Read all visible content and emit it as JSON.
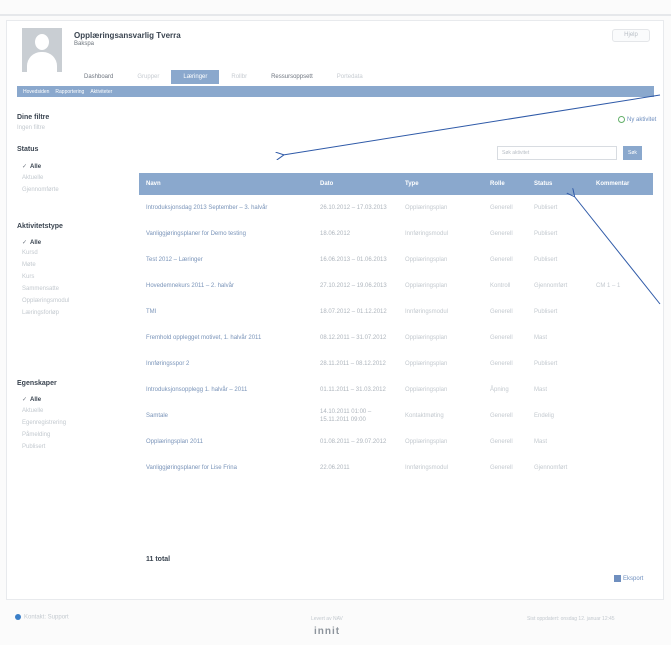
{
  "header": {
    "title": "Opplæringsansvarlig Tverra",
    "subtitle": "Bakspa",
    "help_label": "Hjelp"
  },
  "tabs": [
    {
      "label": "Dashboard",
      "state": "normal"
    },
    {
      "label": "Grupper",
      "state": "faint"
    },
    {
      "label": "Læringer",
      "state": "active"
    },
    {
      "label": "Rollbr",
      "state": "faint"
    },
    {
      "label": "Ressursoppsett",
      "state": "normal"
    },
    {
      "label": "Portedata",
      "state": "faint"
    }
  ],
  "subnav": [
    "Hovedsiden",
    "Rapportering",
    "Aktiviteter"
  ],
  "sidebar": {
    "filters_title": "Dine filtre",
    "filters_sub": "Ingen filtre",
    "status": {
      "title": "Status",
      "items": [
        "Alle",
        "Aktuelle",
        "Gjennomførte"
      ]
    },
    "activity_type": {
      "title": "Aktivitetstype",
      "items": [
        "Alle",
        "Kursd",
        "Møte",
        "Kurs",
        "Sammensatte",
        "Opplæringsmodul",
        "Læringsforløp"
      ]
    },
    "properties": {
      "title": "Egenskaper",
      "items": [
        "Alle",
        "Aktuelle",
        "Egenregistrering",
        "Påmelding",
        "Publisert"
      ]
    }
  },
  "new_activity_label": "Ny aktivitet",
  "search": {
    "placeholder": "Søk aktivitet",
    "button": "Søk"
  },
  "table": {
    "columns": [
      "Navn",
      "Dato",
      "Type",
      "Rolle",
      "Status",
      "Kommentar"
    ],
    "rows": [
      {
        "name": "Introduksjonsdag 2013 September – 3. halvår",
        "date": "26.10.2012 – 17.03.2013",
        "type": "Opplæringsplan",
        "role": "Generell",
        "status": "Publisert",
        "comment": ""
      },
      {
        "name": "Vanliggjøringsplaner for Demo testing",
        "date": "18.06.2012",
        "type": "Innføringsmodul",
        "role": "Generell",
        "status": "Publisert",
        "comment": ""
      },
      {
        "name": "Test 2012 – Læringer",
        "date": "16.06.2013 – 01.06.2013",
        "type": "Opplæringsplan",
        "role": "Generell",
        "status": "Publisert",
        "comment": ""
      },
      {
        "name": "Hovedemnekurs 2011 – 2. halvår",
        "date": "27.10.2012 – 19.06.2013",
        "type": "Opplæringsplan",
        "role": "Kontroll",
        "status": "Gjennomført",
        "comment": "CM 1 – 1"
      },
      {
        "name": "TMI",
        "date": "18.07.2012 – 01.12.2012",
        "type": "Innføringsmodul",
        "role": "Generell",
        "status": "Publisert",
        "comment": ""
      },
      {
        "name": "Fremhold opplegget motivet, 1. halvår 2011",
        "date": "08.12.2011 – 31.07.2012",
        "type": "Opplæringsplan",
        "role": "Generell",
        "status": "Mast",
        "comment": ""
      },
      {
        "name": "Innføringsspor 2",
        "date": "28.11.2011 – 08.12.2012",
        "type": "Opplæringsplan",
        "role": "Generell",
        "status": "Publisert",
        "comment": ""
      },
      {
        "name": "Introduksjonsopplegg 1. halvår – 2011",
        "date": "01.11.2011 – 31.03.2012",
        "type": "Opplæringsplan",
        "role": "Åpning",
        "status": "Mast",
        "comment": ""
      },
      {
        "name": "Samtale",
        "date": "14.10.2011 01:00 – 15.11.2011 09:00",
        "type": "Kontaktmøting",
        "role": "Generell",
        "status": "Endelig",
        "comment": ""
      },
      {
        "name": "Opplæringsplan 2011",
        "date": "01.08.2011 – 29.07.2012",
        "type": "Opplæringsplan",
        "role": "Generell",
        "status": "Mast",
        "comment": ""
      },
      {
        "name": "Vanliggjøringsplaner for Lise Frina",
        "date": "22.06.2011",
        "type": "Innføringsmodul",
        "role": "Generell",
        "status": "Gjennomført",
        "comment": ""
      }
    ]
  },
  "total_label": "11 total",
  "export_label": "Eksport",
  "footer": {
    "left": "Kontakt: Support",
    "center": "Levert av NAV",
    "brand": "innit",
    "right": "Sist oppdatert: onsdag 12. januar 12:45"
  },
  "colors": {
    "accent": "#8aa8cd",
    "arrow": "#2f5aa8"
  }
}
